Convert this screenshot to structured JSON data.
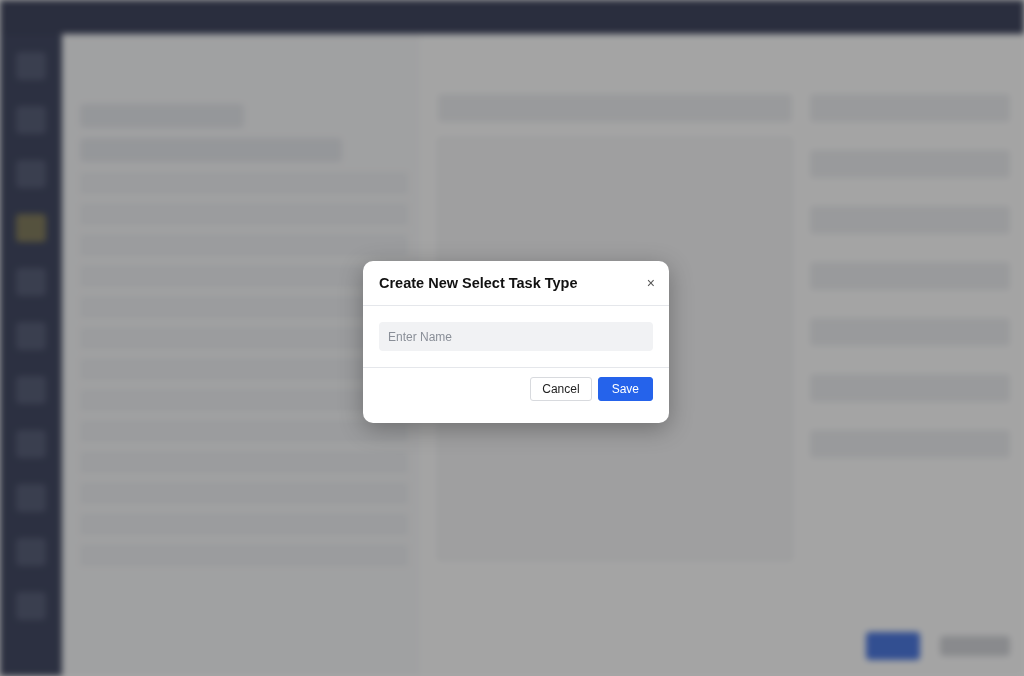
{
  "dialog": {
    "title": "Create New Select Task Type",
    "close": "×",
    "name_field": {
      "placeholder": "Enter Name"
    },
    "buttons": [
      {
        "label": "Cancel",
        "kind": "secondary"
      },
      {
        "label": "Save",
        "kind": "primary"
      }
    ]
  }
}
